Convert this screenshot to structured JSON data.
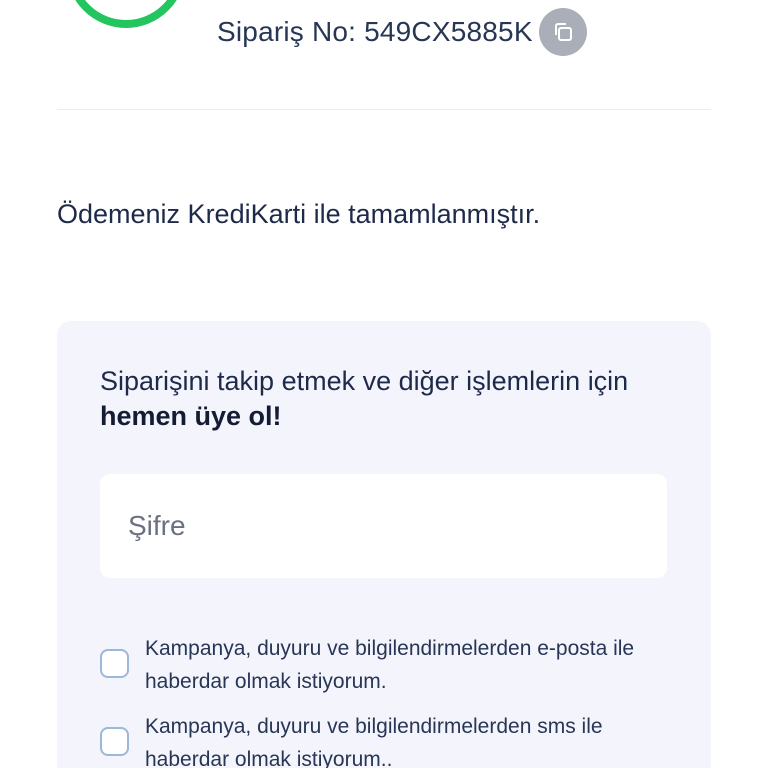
{
  "order": {
    "label": "Sipariş No: 549CX5885K",
    "copy_icon": "copy-icon"
  },
  "payment": {
    "message": "Ödemeniz KrediKarti ile tamamlanmıştır."
  },
  "signup": {
    "heading_prefix": "Siparişini takip etmek ve diğer işlemlerin için ",
    "heading_bold": "hemen üye ol!",
    "password_placeholder": "Şifre",
    "consents": [
      {
        "label": "Kampanya, duyuru ve bilgilendirmelerden e-posta ile haberdar olmak istiyorum.",
        "checked": false
      },
      {
        "label": "Kampanya, duyuru ve bilgilendirmelerden sms ile haberdar olmak istiyorum..",
        "checked": false
      }
    ]
  },
  "colors": {
    "success": "#22c55e",
    "card_background": "#f4f4fc",
    "checkbox_border": "#9bb7d9",
    "text": "#1e2a4a"
  }
}
